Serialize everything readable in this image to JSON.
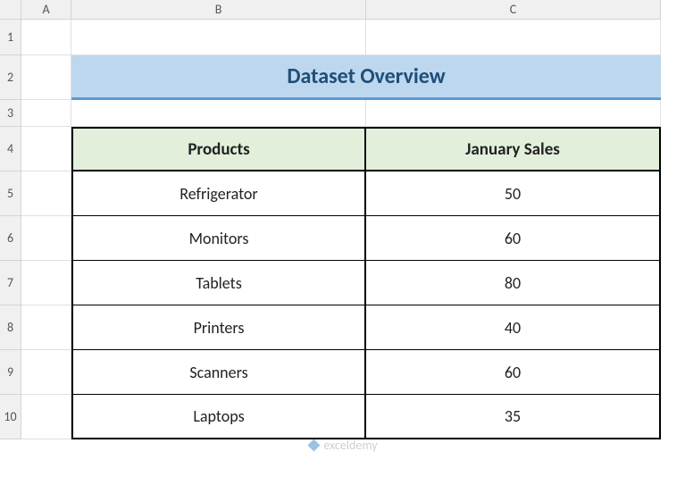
{
  "columns": [
    "A",
    "B",
    "C"
  ],
  "rows": [
    "1",
    "2",
    "3",
    "4",
    "5",
    "6",
    "7",
    "8",
    "9",
    "10"
  ],
  "title": "Dataset Overview",
  "table": {
    "headers": {
      "col1": "Products",
      "col2": "January Sales"
    },
    "data": [
      {
        "product": "Refrigerator",
        "sales": "50"
      },
      {
        "product": "Monitors",
        "sales": "60"
      },
      {
        "product": "Tablets",
        "sales": "80"
      },
      {
        "product": "Printers",
        "sales": "40"
      },
      {
        "product": "Scanners",
        "sales": "60"
      },
      {
        "product": "Laptops",
        "sales": "35"
      }
    ]
  },
  "watermark": "exceldemy",
  "chart_data": {
    "type": "table",
    "title": "Dataset Overview",
    "columns": [
      "Products",
      "January Sales"
    ],
    "rows": [
      [
        "Refrigerator",
        50
      ],
      [
        "Monitors",
        60
      ],
      [
        "Tablets",
        80
      ],
      [
        "Printers",
        40
      ],
      [
        "Scanners",
        60
      ],
      [
        "Laptops",
        35
      ]
    ]
  }
}
